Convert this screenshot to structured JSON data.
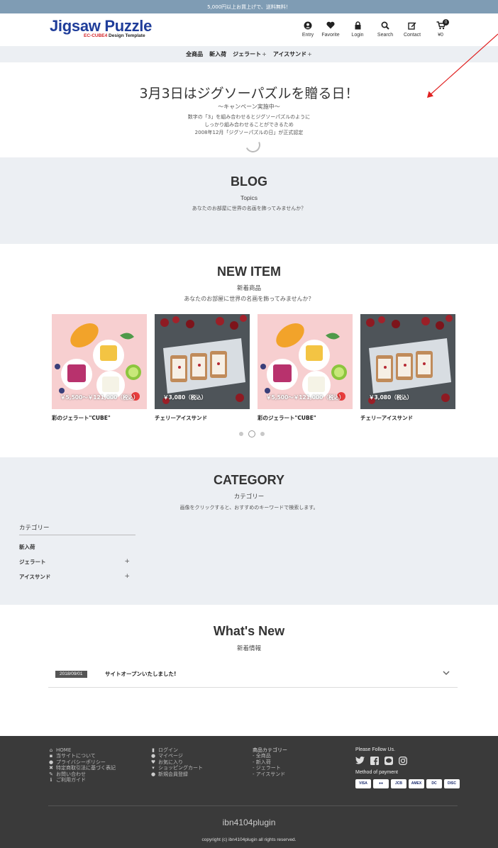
{
  "announcement": "5,000円以上お買上げで、送料無料！",
  "logo": {
    "main": "Jigsaw Puzzle",
    "sub_red": "EC-CUBE4",
    "sub_dark": " Design Template"
  },
  "header_nav": [
    {
      "label": "Entry",
      "icon": "user-icon"
    },
    {
      "label": "Favorite",
      "icon": "heart-icon"
    },
    {
      "label": "Login",
      "icon": "lock-icon"
    },
    {
      "label": "Search",
      "icon": "search-icon"
    },
    {
      "label": "Contact",
      "icon": "edit-icon"
    },
    {
      "label": "¥0",
      "icon": "cart-icon",
      "badge": "0"
    }
  ],
  "category_nav": [
    {
      "label": "全商品",
      "plus": ""
    },
    {
      "label": "新入荷",
      "plus": ""
    },
    {
      "label": "ジェラート",
      "plus": "+"
    },
    {
      "label": "アイスサンド",
      "plus": "+"
    }
  ],
  "hero": {
    "title": "3月3日はジグソーパズルを贈る日！",
    "subtitle": "〜キャンペーン実施中〜",
    "lines": [
      "数字の「3」を組み合わせるとジグソーパズルのように",
      "しっかり組み合わせることができるため",
      "2008年12月「ジグソーパズルの日」が正式認定"
    ]
  },
  "blog": {
    "title": "BLOG",
    "subtitle": "Topics",
    "desc": "あなたのお部屋に世界の名画を飾ってみませんか？"
  },
  "new_item": {
    "title": "NEW ITEM",
    "subtitle": "新着商品",
    "desc": "あなたのお部屋に世界の名画を飾ってみませんか？",
    "items": [
      {
        "name": "彩のジェラート\"CUBE\"",
        "price": "￥5,500～￥121,000（税込）",
        "kind": "gelato"
      },
      {
        "name": "チェリーアイスサンド",
        "price": "￥3,080（税込）",
        "kind": "sandwich"
      },
      {
        "name": "彩のジェラート\"CUBE\"",
        "price": "￥5,500～￥121,000（税込）",
        "kind": "gelato"
      },
      {
        "name": "チェリーアイスサンド",
        "price": "￥3,080（税込）",
        "kind": "sandwich"
      }
    ]
  },
  "category": {
    "title": "CATEGORY",
    "subtitle": "カテゴリー",
    "desc": "画像をクリックすると、おすすめのキーワードで検索します。",
    "sidebar_head": "カテゴリー",
    "rows": [
      {
        "label": "新入荷",
        "plus": ""
      },
      {
        "label": "ジェラート",
        "plus": "+"
      },
      {
        "label": "アイスサンド",
        "plus": "+"
      }
    ]
  },
  "whats_new": {
    "title": "What's New",
    "subtitle": "新着情報",
    "news": [
      {
        "date": "2018/09/01",
        "title": "サイトオープンいたしました!"
      }
    ]
  },
  "footer": {
    "col1": [
      {
        "icon": "home-icon",
        "glyph": "⌂",
        "label": "HOME"
      },
      {
        "icon": "info-icon",
        "glyph": "▪",
        "label": "当サイトについて"
      },
      {
        "icon": "privacy-icon",
        "glyph": "●",
        "label": "プライバシーポリシー"
      },
      {
        "icon": "law-icon",
        "glyph": "✖",
        "label": "特定商取引法に基づく表記"
      },
      {
        "icon": "mail-icon",
        "glyph": "✎",
        "label": "お問い合わせ"
      },
      {
        "icon": "guide-icon",
        "glyph": "ℹ",
        "label": "ご利用ガイド"
      }
    ],
    "col2": [
      {
        "icon": "lock-icon",
        "glyph": "▮",
        "label": "ログイン"
      },
      {
        "icon": "mypage-icon",
        "glyph": "●",
        "label": "マイページ"
      },
      {
        "icon": "heart-icon",
        "glyph": "♥",
        "label": "お気に入り"
      },
      {
        "icon": "cart-icon",
        "glyph": "▾",
        "label": "ショッピングカート"
      },
      {
        "icon": "user-icon",
        "glyph": "●",
        "label": "新規会員登録"
      }
    ],
    "col3_head": "商品カテゴリー",
    "col3": [
      "全商品",
      "新入荷",
      "ジェラート",
      "アイスサンド"
    ],
    "follow": "Please Follow Us.",
    "payment": "Method of payment",
    "cards": [
      "VISA",
      "●●",
      "JCB",
      "AMEX",
      "DC",
      "DISC"
    ],
    "brand": "ibn4104plugin",
    "copyright": "copyright (c) ibn4104plugin all rights reserved."
  }
}
